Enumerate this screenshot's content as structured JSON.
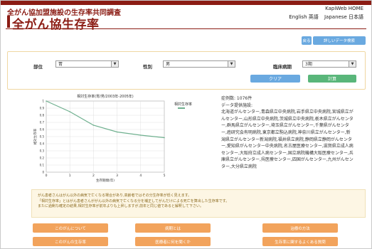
{
  "header": {
    "subtitle": "全がん協加盟施設の生存率共同調査",
    "title": "全がん協生存率",
    "home_link": "KapiWeb HOME",
    "lang_english": "English 英語",
    "lang_japanese": "Japanese 日本語"
  },
  "top_buttons": {
    "back": "戻る",
    "detail": "詳しいデータ検索"
  },
  "form": {
    "site_label": "部位",
    "site_value": "胃",
    "sex_label": "性別",
    "sex_value": "男",
    "stage_label": "臨床病期",
    "stage_value": "3期",
    "clear_label": "クリア",
    "calc_label": "計算"
  },
  "info": {
    "cases": "症例数: 1076件",
    "source_label": "データ提供施設:",
    "facilities": "北海道がんセンター,青森県立中央病院,岩手県立中央病院,宮城県立がんセンター,山形県立中央病院,茨城県立中央病院,栃木県立がんセンター,群馬県立がんセンター,埼玉県立がんセンター,千葉県がんセンター,癌研究会有明病院,東京都立駒込病院,神奈川県立がんセンター,新潟県立がんセンター新潟病院,福井県立病院,静岡県立静岡がんセンター,愛知県がんセンター中央病院,名古屋医療センター,滋賀県立成人病センター,大阪府立成人病センター,国立病院機構大阪医療センター,兵庫県立がんセンター,呉医療センター,四国がんセンター,九州がんセンター,大分県立病院"
  },
  "note": {
    "line1": "がん患者さんはがん以外の病気で亡くなる場合があり,高齢者ではその分生存率が低く見えます。",
    "line2": "「相対生存率」とはがん患者さんががん以外の病気で亡くなる分を補正してがんだけによる死亡を算出した生存率です。",
    "line3": "またに過剰な確定の結果,相対生存率が前年よりも上昇しますが,前年と同じ値であると解釈して下さい。"
  },
  "nav": {
    "about_cancer": "このがんについて",
    "stage_info": "病期とは",
    "treatment": "治療の方法",
    "survival": "このがんの生存率",
    "ask_doctor": "医療者に何を聞くか",
    "faq": "生存率に関するよくある質問"
  },
  "chart_data": {
    "type": "line",
    "title": "相対生存率(胃/男/2003年-2005年)",
    "xlabel": "生存期間(年)",
    "ylabel": "相対生存率",
    "x": [
      0,
      1,
      2,
      3,
      4,
      5
    ],
    "series": [
      {
        "name": "相対生存率",
        "values": [
          1.0,
          0.85,
          0.66,
          0.565,
          0.52,
          0.485
        ],
        "color": "#6fb08f"
      }
    ],
    "xlim": [
      0,
      5
    ],
    "ylim": [
      0,
      1
    ],
    "xticks": [
      "0",
      "1",
      "2",
      "3",
      "4",
      "5"
    ],
    "yticks": [
      "0",
      "0.1",
      "0.2",
      "0.3",
      "0.4",
      "0.5",
      "0.6",
      "0.7",
      "0.8",
      "0.9",
      "1"
    ],
    "grid": true,
    "legend": "right"
  }
}
